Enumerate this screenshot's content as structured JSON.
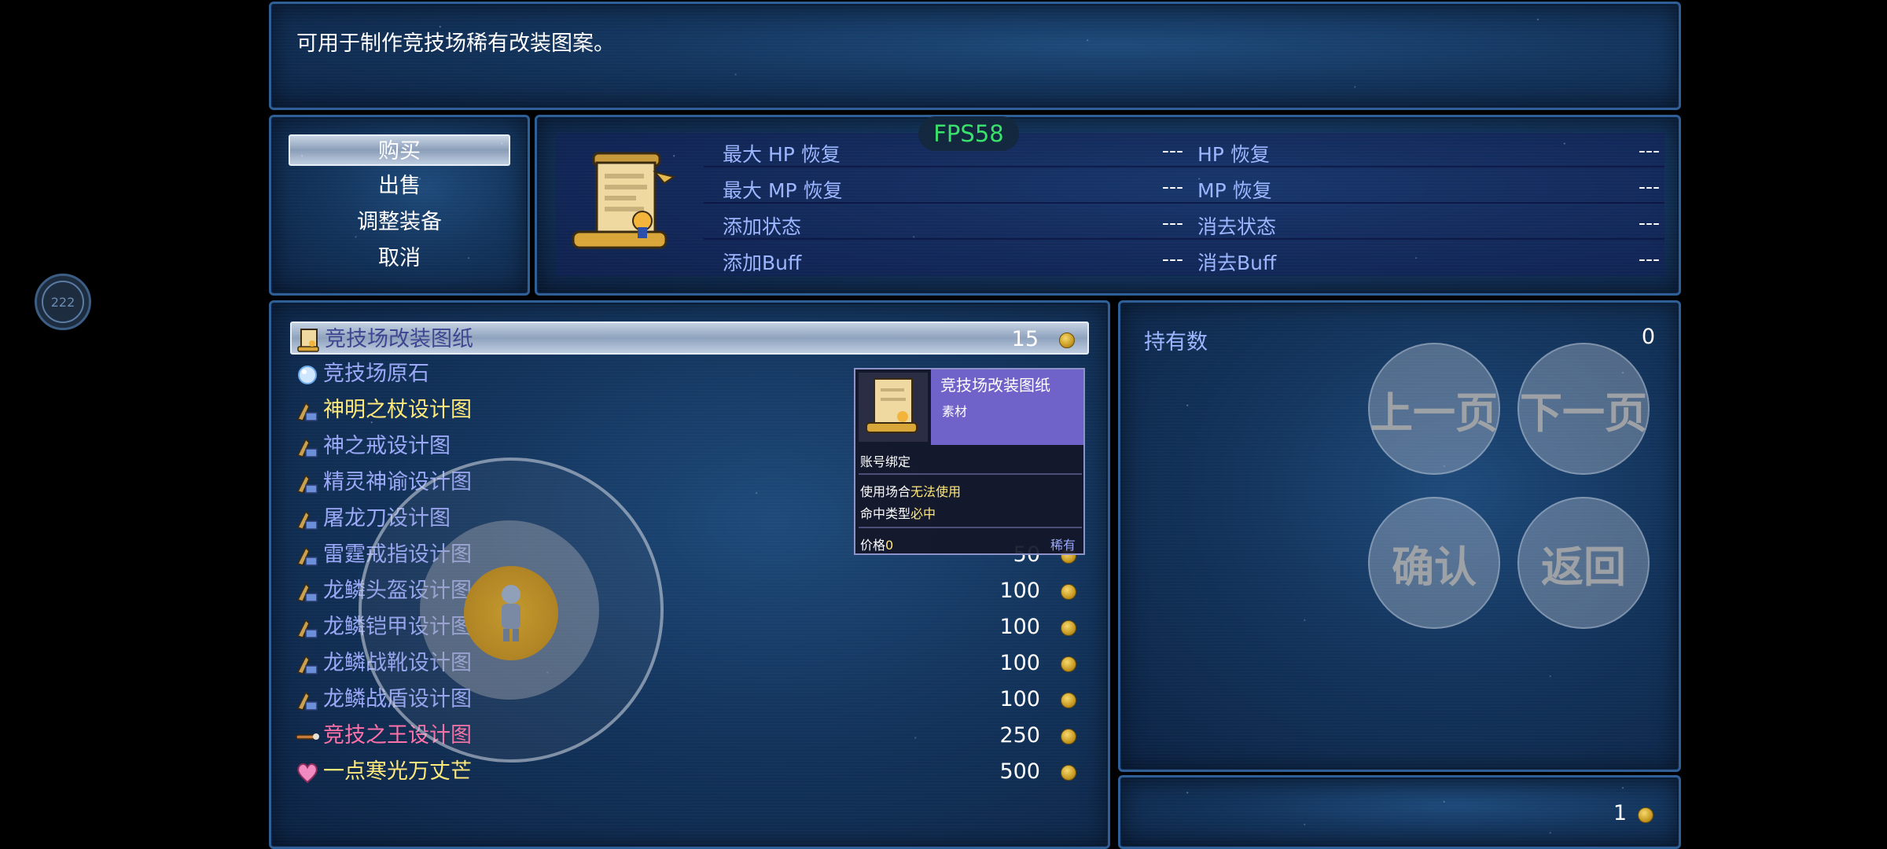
{
  "help": {
    "text": "可用于制作竞技场稀有改装图案。"
  },
  "fps": "FPS58",
  "commands": [
    {
      "label": "购买",
      "selected": true
    },
    {
      "label": "出售",
      "selected": false
    },
    {
      "label": "调整装备",
      "selected": false
    },
    {
      "label": "取消",
      "selected": false
    }
  ],
  "status": {
    "icon": "scroll-icon",
    "params": [
      {
        "label": "最大 HP 恢复",
        "value": "---"
      },
      {
        "label": "HP 恢复",
        "value": "---"
      },
      {
        "label": "最大 MP 恢复",
        "value": "---"
      },
      {
        "label": "MP 恢复",
        "value": "---"
      },
      {
        "label": "添加状态",
        "value": "---"
      },
      {
        "label": "消去状态",
        "value": "---"
      },
      {
        "label": "添加Buff",
        "value": "---"
      },
      {
        "label": "消去Buff",
        "value": "---"
      }
    ]
  },
  "shop": {
    "items": [
      {
        "name": "竞技场改装图纸",
        "price": "15",
        "icon": "scroll-icon",
        "color": "dark",
        "selected": true
      },
      {
        "name": "竞技场原石",
        "price": "",
        "icon": "crystal-orb-icon",
        "color": "normal"
      },
      {
        "name": "神明之杖设计图",
        "price": "",
        "icon": "blueprint-icon",
        "color": "yellow"
      },
      {
        "name": "神之戒设计图",
        "price": "",
        "icon": "blueprint-icon",
        "color": "normal"
      },
      {
        "name": "精灵神谕设计图",
        "price": "",
        "icon": "blueprint-icon",
        "color": "normal"
      },
      {
        "name": "屠龙刀设计图",
        "price": "",
        "icon": "blueprint-icon",
        "color": "normal"
      },
      {
        "name": "雷霆戒指设计图",
        "price": "50",
        "icon": "blueprint-icon",
        "color": "normal"
      },
      {
        "name": "龙鳞头盔设计图",
        "price": "100",
        "icon": "blueprint-icon",
        "color": "normal"
      },
      {
        "name": "龙鳞铠甲设计图",
        "price": "100",
        "icon": "blueprint-icon",
        "color": "normal"
      },
      {
        "name": "龙鳞战靴设计图",
        "price": "100",
        "icon": "blueprint-icon",
        "color": "normal"
      },
      {
        "name": "龙鳞战盾设计图",
        "price": "100",
        "icon": "blueprint-icon",
        "color": "normal"
      },
      {
        "name": "竞技之王设计图",
        "price": "250",
        "icon": "wand-icon",
        "color": "pink"
      },
      {
        "name": "一点寒光万丈芒",
        "price": "500",
        "icon": "heart-gem-icon",
        "color": "yellow"
      }
    ]
  },
  "possession": {
    "label": "持有数",
    "value": "0"
  },
  "gold": {
    "value": "1"
  },
  "touch_buttons": {
    "prev_page": "上一页",
    "next_page": "下一页",
    "confirm": "确认",
    "back": "返回"
  },
  "tooltip": {
    "name": "竞技场改装图纸",
    "type": "素材",
    "binding": "账号绑定",
    "usage_label": "使用场合",
    "usage_value": "无法使用",
    "hit_label": "命中类型",
    "hit_value": "必中",
    "price_label": "价格",
    "price_value": "0",
    "rarity": "稀有"
  },
  "mini_widget": {
    "label": "222"
  },
  "colors": {
    "panel_bg": "#13345c",
    "panel_border": "#2e5f96",
    "system_text": "#9cb6ff",
    "fps_green": "#39e26a",
    "item_yellow": "#ffe97a",
    "item_pink": "#ff6fa8",
    "tooltip_purple": "#6f62c8"
  }
}
